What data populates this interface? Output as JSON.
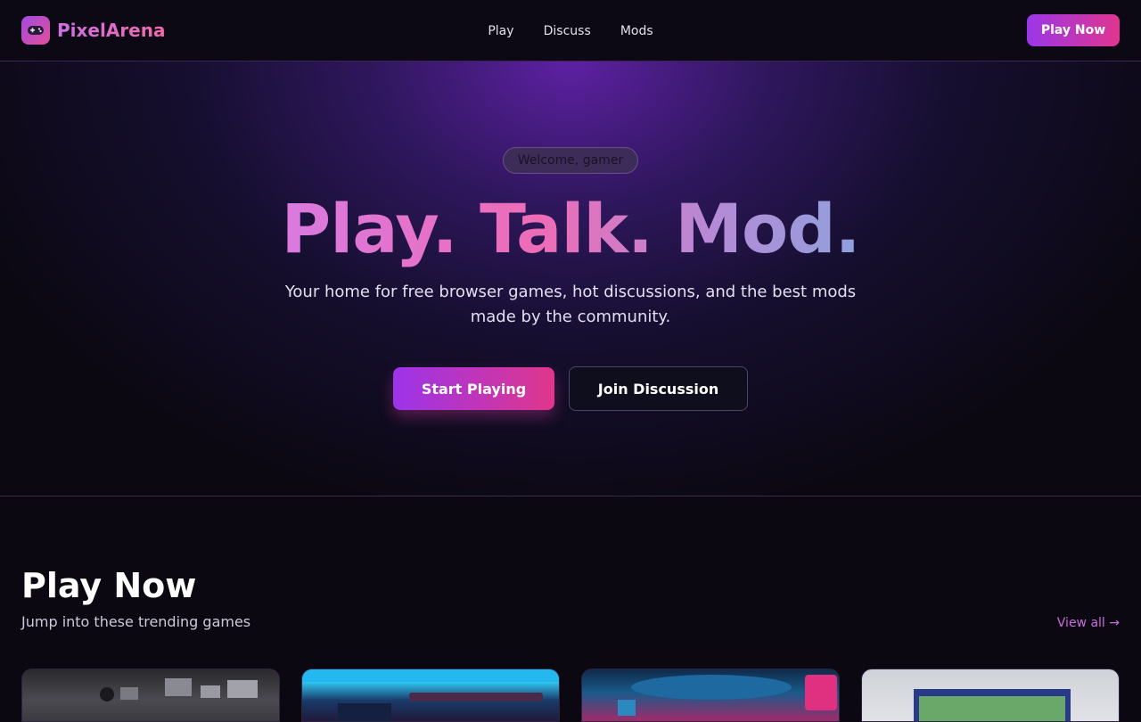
{
  "header": {
    "logo_text": "PixelArena",
    "logo_icon": "gamepad-icon",
    "nav": [
      "Play",
      "Discuss",
      "Mods"
    ],
    "cta_label": "Play Now"
  },
  "hero": {
    "badge": "Welcome, gamer",
    "title": "Play. Talk. Mod.",
    "subtitle": "Your home for free browser games, hot discussions, and the best mods made by the community.",
    "primary_button": "Start Playing",
    "secondary_button": "Join Discussion"
  },
  "play_section": {
    "title": "Play Now",
    "subtitle": "Jump into these trending games",
    "view_all": "View all →"
  },
  "colors": {
    "accent_purple": "#9b37e8",
    "accent_pink": "#e0358f",
    "background": "#0b0812"
  }
}
